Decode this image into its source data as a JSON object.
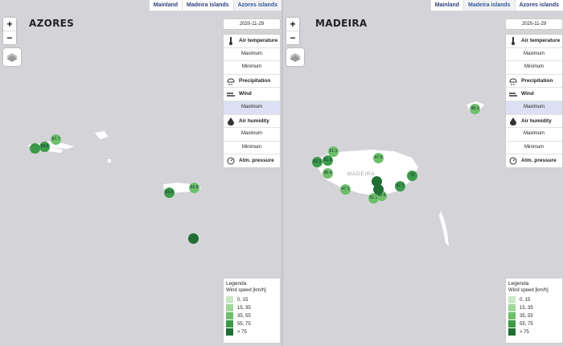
{
  "tabs": [
    "Mainland",
    "Madeira islands",
    "Azores islands"
  ],
  "left_map": {
    "title": "AZORES",
    "tabs": [
      "Mainland",
      "Madeira islands",
      "Azores islands"
    ],
    "markers": [
      "67.7",
      "64.6",
      "63.6",
      "66.8"
    ]
  },
  "right_map": {
    "title": "MADEIRA",
    "tabs": [
      "Mainland",
      "Madeira islands",
      "Azores islands"
    ],
    "madeira_label": "MADEIRA",
    "markers": [
      "48.1",
      "51.1",
      "51.0",
      "62.2",
      "47.9",
      "45.4",
      "47.1",
      "72",
      "67.7",
      "51.1",
      "46.6"
    ]
  },
  "date": "2020-11-29",
  "zoom_in": "+",
  "zoom_out": "−",
  "panel": [
    {
      "label": "Air temperature",
      "type": "head",
      "icon": "thermometer-icon"
    },
    {
      "label": "Maximum",
      "type": "sub"
    },
    {
      "label": "Minimum",
      "type": "sub"
    },
    {
      "label": "Precipitation",
      "type": "head",
      "icon": "rain-cloud-icon"
    },
    {
      "label": "Wind",
      "type": "head",
      "icon": "wind-icon"
    },
    {
      "label": "Maximum",
      "type": "sub",
      "selected": true
    },
    {
      "label": "Air humidity",
      "type": "head",
      "icon": "humidity-icon"
    },
    {
      "label": "Maximum",
      "type": "sub"
    },
    {
      "label": "Minimum",
      "type": "sub"
    },
    {
      "label": "Atm. pressure",
      "type": "head",
      "icon": "pressure-icon"
    }
  ],
  "legend": {
    "title": "Legenda",
    "subtitle": "Wind speed [km/h]",
    "items": [
      {
        "label": "0, 15",
        "color": "#c9e9c4"
      },
      {
        "label": "15, 35",
        "color": "#a3d89b"
      },
      {
        "label": "35, 55",
        "color": "#6dbf6a"
      },
      {
        "label": "55, 75",
        "color": "#3c9a4a"
      },
      {
        "label": "> 75",
        "color": "#1f6e34"
      }
    ]
  },
  "colors": {
    "background": "#d4d4d8",
    "land": "#ffffff",
    "selected": "#dde0f2",
    "tab_text": "#2f3e7a"
  }
}
